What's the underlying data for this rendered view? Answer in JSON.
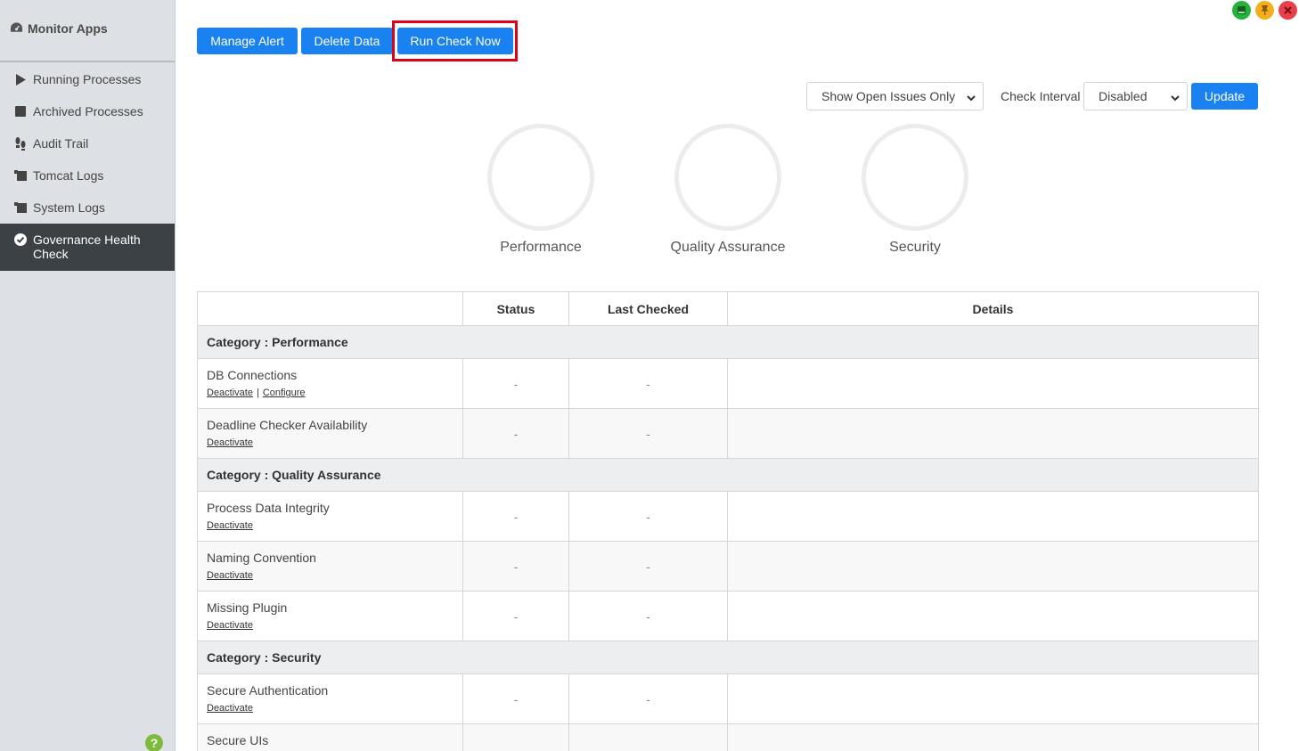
{
  "sidebar": {
    "title": "Monitor Apps",
    "items": [
      {
        "label": "Running Processes",
        "icon": "play-icon"
      },
      {
        "label": "Archived Processes",
        "icon": "stop-icon"
      },
      {
        "label": "Audit Trail",
        "icon": "footprints-icon"
      },
      {
        "label": "Tomcat Logs",
        "icon": "scroll-icon"
      },
      {
        "label": "System Logs",
        "icon": "scroll-icon"
      },
      {
        "label": "Governance Health Check",
        "icon": "check-circle-icon",
        "active": true
      }
    ],
    "help": "?"
  },
  "toolbar": {
    "manage_alert": "Manage Alert",
    "delete_data": "Delete Data",
    "run_check_now": "Run Check Now"
  },
  "filters": {
    "issues_select": "Show Open Issues Only",
    "check_interval_label": "Check Interval",
    "interval_select": "Disabled",
    "update": "Update"
  },
  "gauges": {
    "performance": "Performance",
    "quality_assurance": "Quality Assurance",
    "security": "Security"
  },
  "table": {
    "headers": {
      "name": "",
      "status": "Status",
      "last_checked": "Last Checked",
      "details": "Details"
    },
    "categories": {
      "performance": "Category : Performance",
      "qa": "Category : Quality Assurance",
      "security": "Category : Security"
    },
    "rows": [
      {
        "name": "DB Connections",
        "link1": "Deactivate",
        "link2": "Configure",
        "status": "-",
        "last_checked": "-"
      },
      {
        "name": "Deadline Checker Availability",
        "link1": "Deactivate",
        "status": "-",
        "last_checked": "-"
      },
      {
        "name": "Process Data Integrity",
        "link1": "Deactivate",
        "status": "-",
        "last_checked": "-"
      },
      {
        "name": "Naming Convention",
        "link1": "Deactivate",
        "status": "-",
        "last_checked": "-"
      },
      {
        "name": "Missing Plugin",
        "link1": "Deactivate",
        "status": "-",
        "last_checked": "-"
      },
      {
        "name": "Secure Authentication",
        "link1": "Deactivate",
        "status": "-",
        "last_checked": "-"
      },
      {
        "name": "Secure UIs"
      }
    ]
  },
  "colors": {
    "primary": "#1a82f0",
    "highlight": "#e0001b",
    "sidebar_active": "#3c4145"
  }
}
